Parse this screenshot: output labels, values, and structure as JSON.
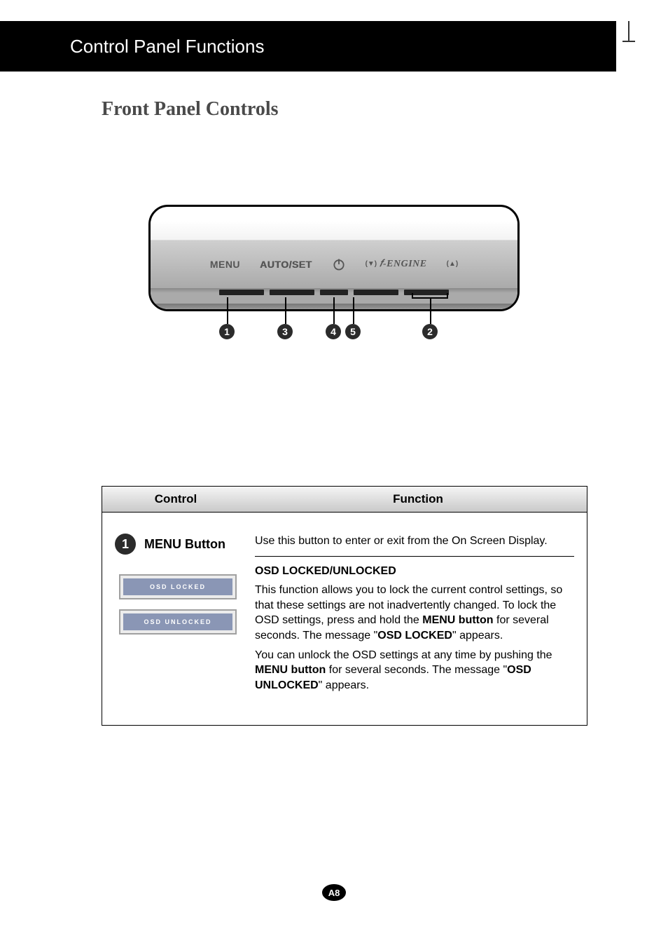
{
  "header": {
    "title": "Control Panel Functions"
  },
  "section": {
    "title": "Front Panel Controls"
  },
  "panel": {
    "labels": {
      "menu": "MENU",
      "autoset": "AUTO/SET",
      "fengine": "𝑓-ENGINE"
    },
    "arrows": {
      "down": "(▼)",
      "up": "(▲)"
    },
    "callouts": {
      "c1": "1",
      "c2": "2",
      "c3": "3",
      "c4": "4",
      "c5": "5"
    }
  },
  "table": {
    "head": {
      "control": "Control",
      "function": "Function"
    },
    "row1": {
      "num": "1",
      "name": "MENU Button",
      "badges": {
        "locked": "OSD LOCKED",
        "unlocked": "OSD UNLOCKED"
      },
      "intro": "Use this button to enter or exit from the On Screen Display.",
      "subhead": "OSD LOCKED/UNLOCKED",
      "p1_a": "This function allows you to lock the current control settings, so that these settings are not inadvertently changed. To lock the OSD settings, press and hold the ",
      "p1_b": "MENU button",
      "p1_c": " for several seconds. The message \"",
      "p1_d": "OSD LOCKED",
      "p1_e": "\" appears.",
      "p2_a": "You can unlock the OSD settings at any time by pushing the ",
      "p2_b": "MENU button",
      "p2_c": " for several seconds. The message \"",
      "p2_d": "OSD UNLOCKED",
      "p2_e": "\" appears."
    }
  },
  "page": {
    "num": "A8"
  }
}
